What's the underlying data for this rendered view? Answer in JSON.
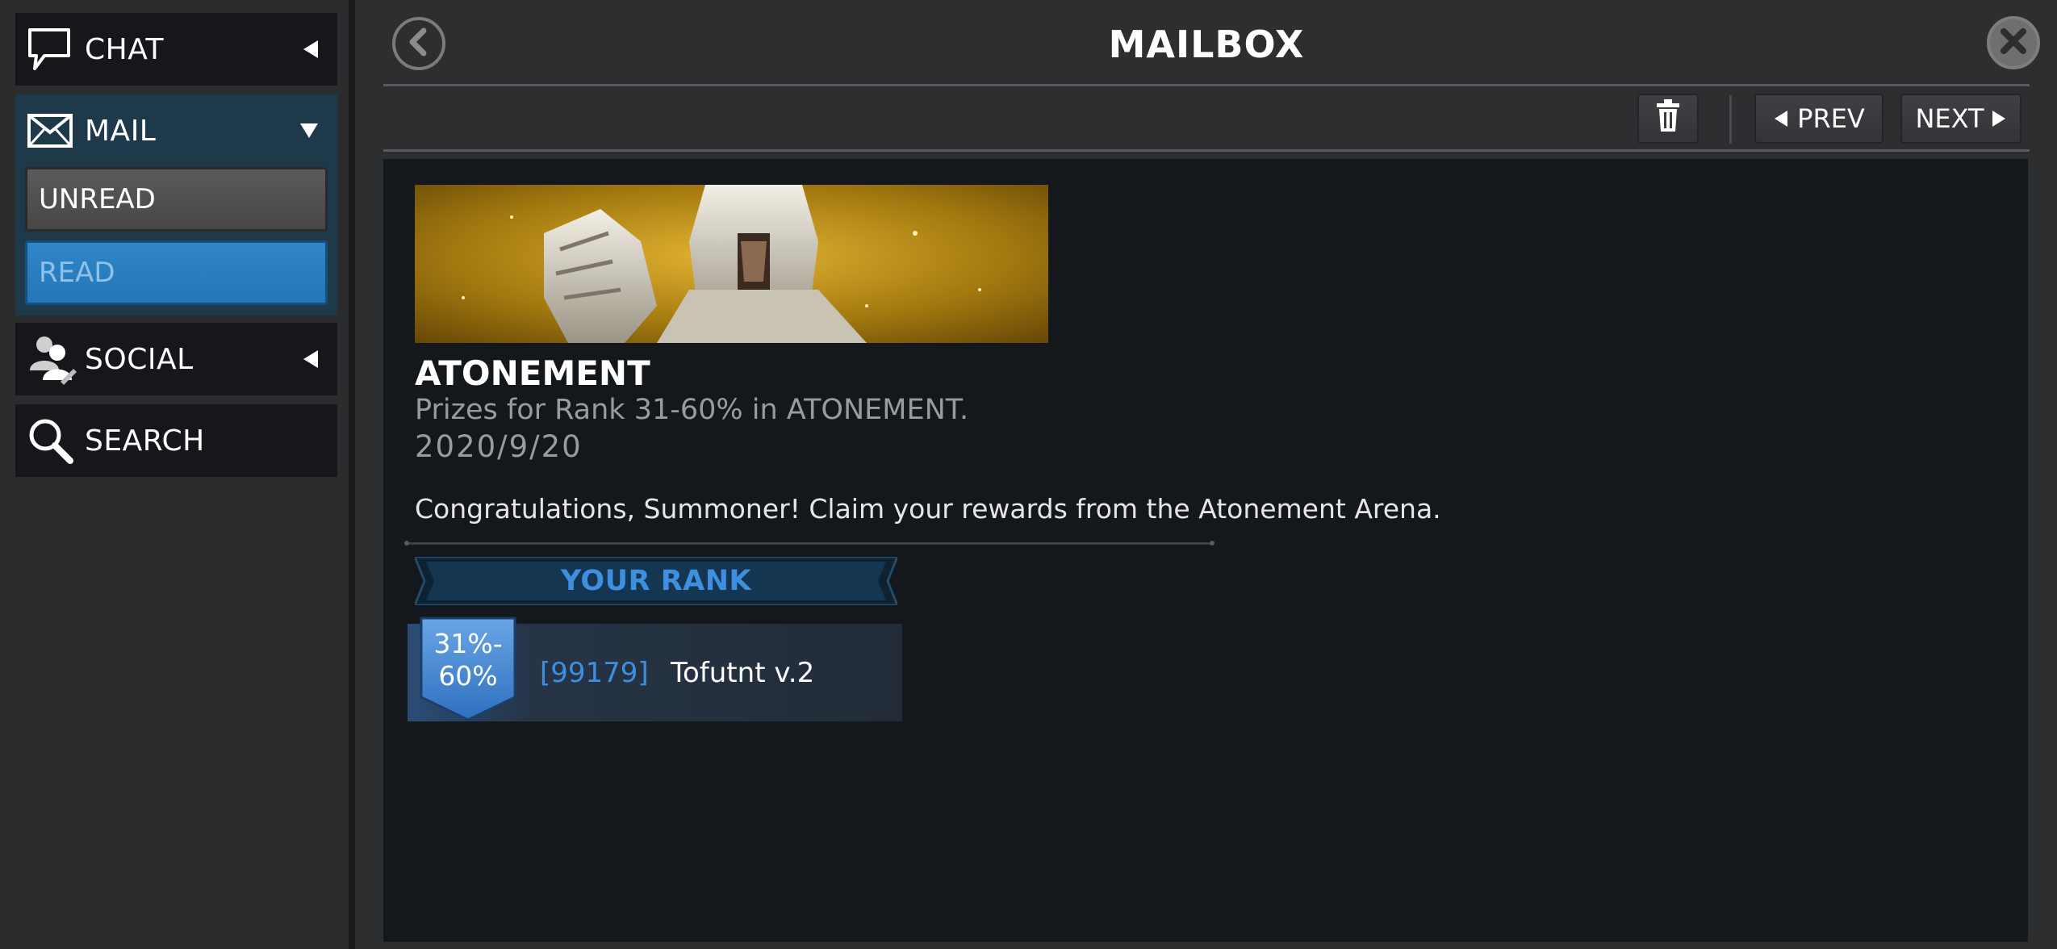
{
  "sidebar": {
    "chat": {
      "label": "CHAT",
      "icon": "chat-bubble-icon"
    },
    "mail": {
      "label": "MAIL",
      "icon": "envelope-icon",
      "sub_items": [
        {
          "label": "UNREAD",
          "selected": false
        },
        {
          "label": "READ",
          "selected": true
        }
      ]
    },
    "social": {
      "label": "SOCIAL",
      "icon": "social-people-icon"
    },
    "search": {
      "label": "SEARCH",
      "icon": "search-icon"
    }
  },
  "header": {
    "title": "MAILBOX",
    "back_icon": "back-arrow-icon",
    "close_icon": "close-x-icon"
  },
  "toolbar": {
    "delete_icon": "trash-icon",
    "prev_label": "PREV",
    "next_label": "NEXT"
  },
  "mail": {
    "title": "ATONEMENT",
    "subtitle": "Prizes for Rank 31-60% in ATONEMENT.",
    "date": "2020/9/20",
    "body": "Congratulations, Summoner! Claim your rewards from the Atonement Arena.",
    "rank_header": "YOUR RANK",
    "rank": {
      "badge_line1": "31%-",
      "badge_line2": "60%",
      "player_id": "[99179]",
      "player_name": "Tofutnt v.2"
    }
  },
  "colors": {
    "accent_blue": "#3f8fe0",
    "read_button": "#2a7dc0",
    "content_bg": "#14171c"
  }
}
